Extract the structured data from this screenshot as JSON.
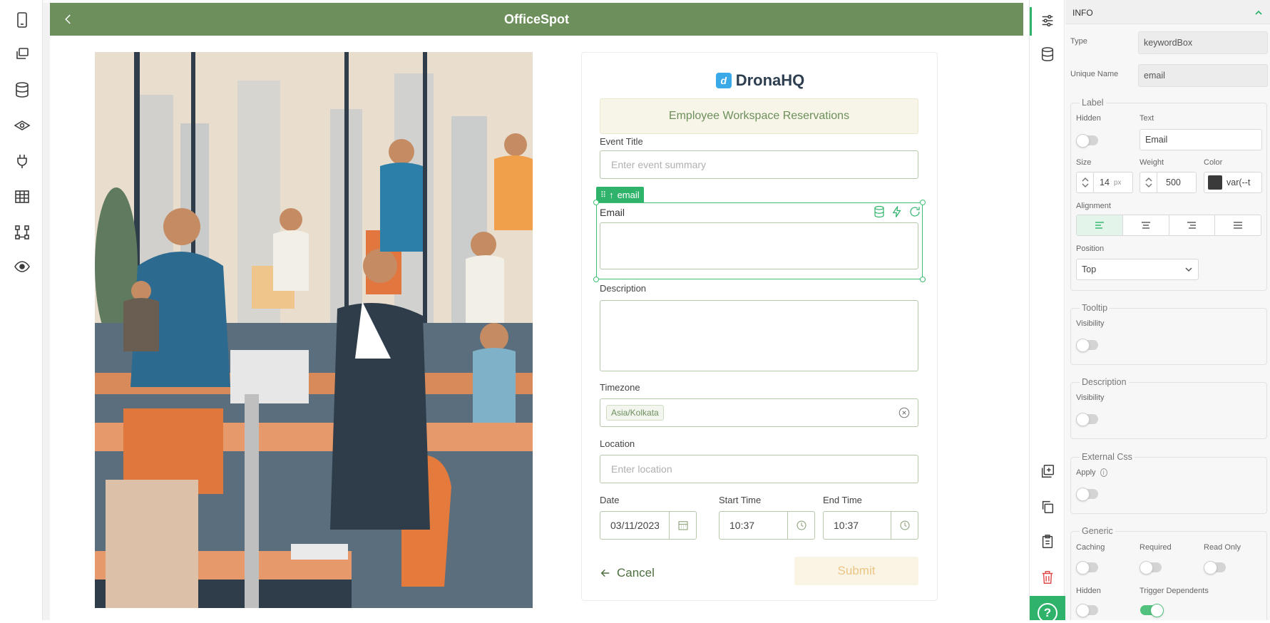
{
  "app": {
    "title": "OfficeSpot"
  },
  "brand": {
    "logo_letter": "d",
    "name": "DronaHQ"
  },
  "form": {
    "title": "Employee Workspace Reservations",
    "event_title": {
      "label": "Event Title",
      "placeholder": "Enter event summary"
    },
    "email": {
      "label": "Email",
      "value": ""
    },
    "selected_tag": "email",
    "description": {
      "label": "Description",
      "value": ""
    },
    "timezone": {
      "label": "Timezone",
      "chip": "Asia/Kolkata"
    },
    "location": {
      "label": "Location",
      "placeholder": "Enter location"
    },
    "date": {
      "label": "Date",
      "value": "03/11/2023"
    },
    "start_time": {
      "label": "Start Time",
      "value": "10:37"
    },
    "end_time": {
      "label": "End Time",
      "value": "10:37"
    },
    "cancel_label": "Cancel",
    "submit_label": "Submit"
  },
  "panel": {
    "header": "INFO",
    "type_label": "Type",
    "type_value": "keywordBox",
    "unique_name_label": "Unique Name",
    "unique_name_value": "email",
    "label_group": {
      "title": "Label",
      "hidden_label": "Hidden",
      "hidden_on": false,
      "text_label": "Text",
      "text_value": "Email",
      "size_label": "Size",
      "size_value": "14",
      "size_unit": "px",
      "weight_label": "Weight",
      "weight_value": "500",
      "color_label": "Color",
      "color_value": "var(--t",
      "alignment_label": "Alignment",
      "position_label": "Position",
      "position_value": "Top"
    },
    "tooltip_group": {
      "title": "Tooltip",
      "visibility_label": "Visibility",
      "visibility_on": false
    },
    "description_group": {
      "title": "Description",
      "visibility_label": "Visibility",
      "visibility_on": false
    },
    "external_css_group": {
      "title": "External Css",
      "apply_label": "Apply",
      "apply_on": false
    },
    "generic_group": {
      "title": "Generic",
      "caching_label": "Caching",
      "required_label": "Required",
      "read_only_label": "Read Only",
      "hidden_label": "Hidden",
      "trigger_dependents_label": "Trigger Dependents",
      "caching_on": false,
      "required_on": false,
      "read_only_on": false,
      "hidden_on": false,
      "trigger_dependents_on": true
    }
  },
  "colors": {
    "header_green": "#6d8f5c",
    "accent_green": "#2fb36a",
    "form_title_bg": "#f7f5e8",
    "submit_bg": "#f9f4e4",
    "submit_text": "#ecc585",
    "delete_red": "#e14b4b"
  },
  "icons": {
    "left_bar": [
      "phone-icon",
      "screens-icon",
      "database-icon",
      "eye-layers-icon",
      "plug-icon",
      "table-icon",
      "workflow-icon",
      "preview-eye-icon"
    ],
    "right_rail": [
      "sliders-icon",
      "database-icon",
      "add-control-icon",
      "copy-icon",
      "paste-icon",
      "trash-icon",
      "help-icon"
    ]
  },
  "help_label": "?"
}
